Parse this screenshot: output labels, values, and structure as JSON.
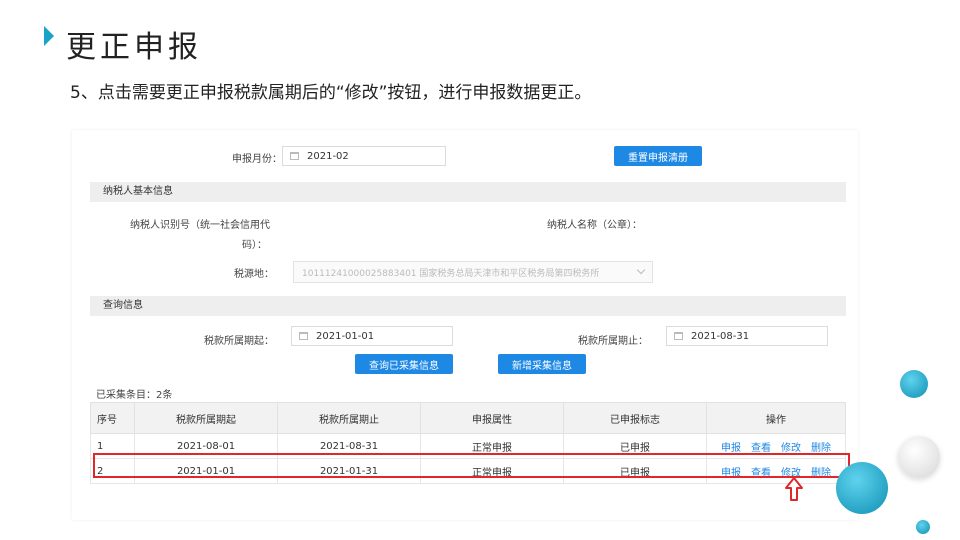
{
  "slide": {
    "title": "更正申报",
    "subtitle": "5、点击需要更正申报税款属期后的“修改”按钮，进行申报数据更正。"
  },
  "form": {
    "month_label": "申报月份：",
    "month_value": "2021-02",
    "reset_button": "重置申报清册",
    "basic_section": "纳税人基本信息",
    "taxpayer_id_label_line1": "纳税人识别号（统一社会信用代",
    "taxpayer_id_label_line2": "码）：",
    "taxpayer_name_label": "纳税人名称（公章）：",
    "tax_source_label": "税源地：",
    "tax_source_value": "10111241000025883401 国家税务总局天津市和平区税务局第四税务所",
    "query_section": "查询信息",
    "period_start_label": "税款所属期起：",
    "period_start_value": "2021-01-01",
    "period_end_label": "税款所属期止：",
    "period_end_value": "2021-08-31",
    "query_button": "查询已采集信息",
    "new_button": "新增采集信息",
    "count_text": "已采集条目：2条"
  },
  "table": {
    "headers": [
      "序号",
      "税款所属期起",
      "税款所属期止",
      "申报属性",
      "已申报标志",
      "操作"
    ],
    "rows": [
      {
        "no": "1",
        "start": "2021-08-01",
        "end": "2021-08-31",
        "attr": "正常申报",
        "flag": "已申报"
      },
      {
        "no": "2",
        "start": "2021-01-01",
        "end": "2021-01-31",
        "attr": "正常申报",
        "flag": "已申报"
      }
    ],
    "actions": {
      "declare": "申报",
      "view": "查看",
      "modify": "修改",
      "delete": "删除"
    }
  },
  "colors": {
    "accent": "#1e88e5",
    "highlight": "#e0282b",
    "flag": "#57b84a",
    "decor": "#1aa3c8"
  }
}
